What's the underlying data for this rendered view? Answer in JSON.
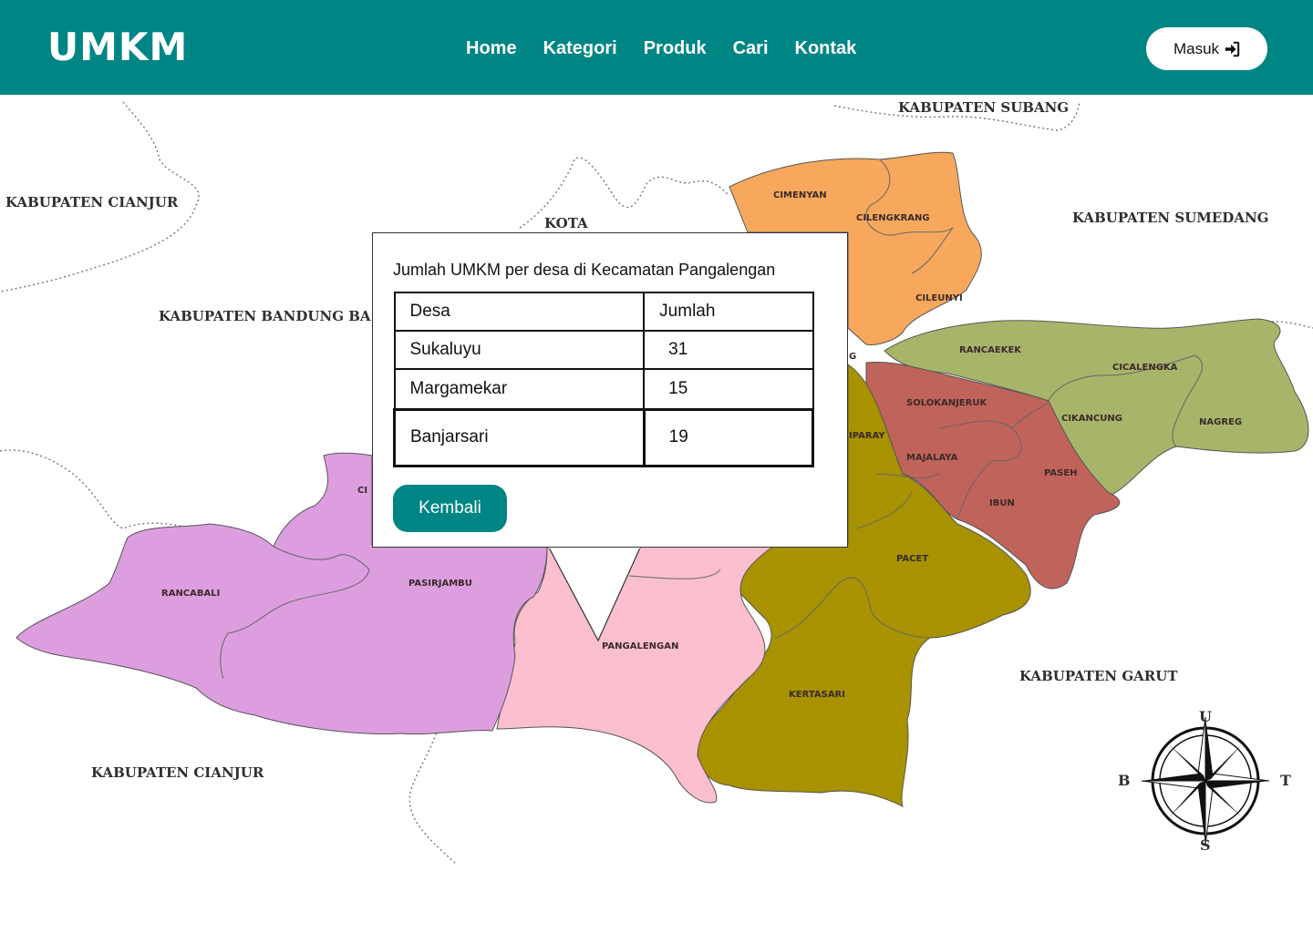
{
  "header": {
    "logo": "UMKM",
    "nav": [
      "Home",
      "Kategori",
      "Produk",
      "Cari",
      "Kontak"
    ],
    "login_label": "Masuk",
    "login_icon": "sign-in-icon",
    "bg_color": "#008585"
  },
  "map": {
    "regions": [
      "KABUPATEN SUBANG",
      "KABUPATEN CIANJUR",
      "KOTA",
      "KABUPATEN SUMEDANG",
      "KABUPATEN BANDUNG BA",
      "KABUPATEN GARUT",
      "KABUPATEN CIANJUR"
    ],
    "districts": [
      "CIMENYAN",
      "CILENGKRANG",
      "CILEUNYI",
      "RANCAEKEK",
      "CICALENGKA",
      "SOLOKANJERUK",
      "CIKANCUNG",
      "NAGREG",
      "MAJALAYA",
      "PASEH",
      "IBUN",
      "PACET",
      "KERTASARI",
      "PANGALENGAN",
      "PASIRJAMBU",
      "RANCABALI",
      "IPARAY",
      "CI",
      "G"
    ],
    "compass": {
      "north": "U",
      "west": "B",
      "east": "T",
      "south": "S"
    }
  },
  "popup": {
    "title": "Jumlah UMKM per desa di Kecamatan Pangalengan",
    "table": {
      "headers": [
        "Desa",
        "Jumlah"
      ],
      "rows": [
        [
          "Sukaluyu",
          "31"
        ],
        [
          "Margamekar",
          "15"
        ],
        [
          "Banjarsari",
          "19"
        ]
      ]
    },
    "back_label": "Kembali"
  }
}
